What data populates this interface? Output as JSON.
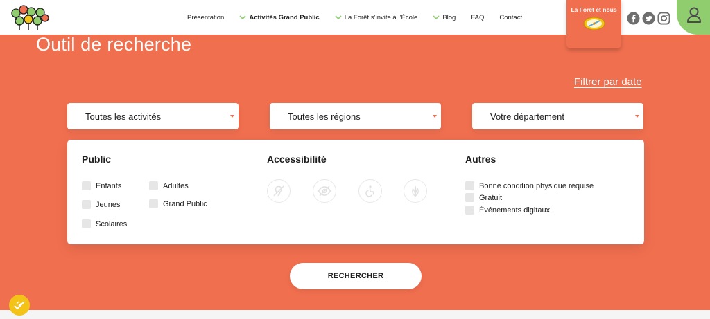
{
  "header": {
    "nav": [
      {
        "label": "Présentation",
        "has_chevron": false,
        "active": false
      },
      {
        "label": "Activités Grand Public",
        "has_chevron": true,
        "active": true
      },
      {
        "label": "La Forêt s’invite à l’École",
        "has_chevron": true,
        "active": false
      },
      {
        "label": "Blog",
        "has_chevron": true,
        "active": false
      },
      {
        "label": "FAQ",
        "has_chevron": false,
        "active": false
      },
      {
        "label": "Contact",
        "has_chevron": false,
        "active": false
      }
    ],
    "promo_label": "La Forêt et nous",
    "socials": [
      "facebook-icon",
      "twitter-icon",
      "instagram-icon"
    ]
  },
  "main": {
    "title": "Outil de recherche",
    "filter_date": "Filtrer par date",
    "selects": {
      "activities": "Toutes les activités",
      "regions": "Toutes les régions",
      "department": "Votre département"
    },
    "public": {
      "title": "Public",
      "options": {
        "enfants": "Enfants",
        "jeunes": "Jeunes",
        "scolaires": "Scolaires",
        "adultes": "Adultes",
        "grand_public": "Grand Public"
      }
    },
    "accessibility": {
      "title": "Accessibilité",
      "icons": [
        "hearing-impaired-icon",
        "visually-impaired-icon",
        "wheelchair-icon",
        "mental-disability-icon"
      ]
    },
    "others": {
      "title": "Autres",
      "options": {
        "condition": "Bonne condition physique requise",
        "gratuit": "Gratuit",
        "digital": "Événements digitaux"
      }
    },
    "search_button": "RECHERCHER"
  },
  "colors": {
    "accent": "#f06f4f",
    "green": "#8fcd6e",
    "yellow": "#f3c318"
  }
}
